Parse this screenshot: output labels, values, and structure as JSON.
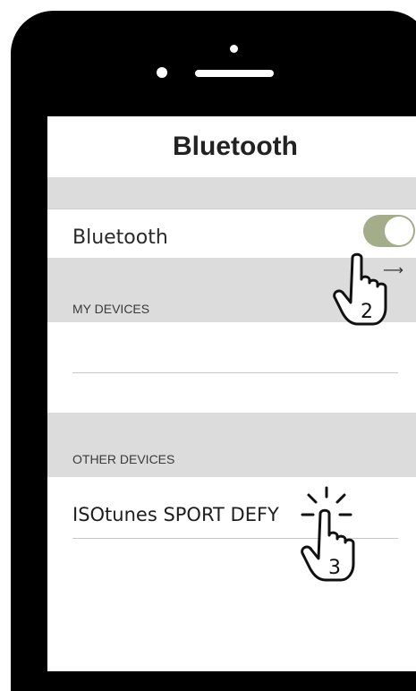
{
  "nav": {
    "title": "Bluetooth"
  },
  "bluetooth_row": {
    "label": "Bluetooth",
    "toggle_on": true,
    "toggle_color": "#a4ad8a"
  },
  "my_devices": {
    "header": "MY DEVICES"
  },
  "other_devices": {
    "header": "OTHER DEVICES",
    "items": [
      {
        "label": "ISOtunes SPORT DEFY"
      }
    ]
  },
  "annotations": {
    "arrow": "⟶",
    "step2": {
      "number": "2",
      "icon": "hand-pointer-icon"
    },
    "step3": {
      "number": "3",
      "icon": "hand-tap-icon"
    }
  }
}
